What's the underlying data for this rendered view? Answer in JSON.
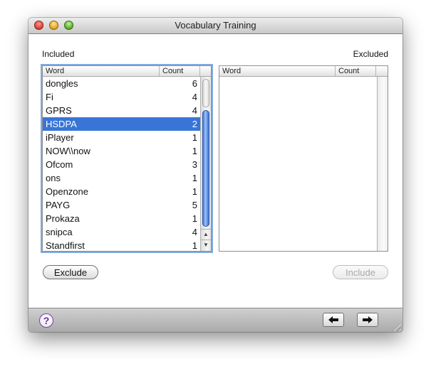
{
  "window": {
    "title": "Vocabulary Training"
  },
  "included": {
    "label": "Included",
    "columns": {
      "word": "Word",
      "count": "Count"
    },
    "rows": [
      {
        "word": "dongles",
        "count": "6"
      },
      {
        "word": "Fi",
        "count": "4"
      },
      {
        "word": "GPRS",
        "count": "4"
      },
      {
        "word": "HSDPA",
        "count": "2",
        "selected": true
      },
      {
        "word": "iPlayer",
        "count": "1"
      },
      {
        "word": "NOW\\\\now",
        "count": "1"
      },
      {
        "word": "Ofcom",
        "count": "3"
      },
      {
        "word": "ons",
        "count": "1"
      },
      {
        "word": "Openzone",
        "count": "1"
      },
      {
        "word": "PAYG",
        "count": "5"
      },
      {
        "word": "Prokaza",
        "count": "1"
      },
      {
        "word": "snipca",
        "count": "4"
      },
      {
        "word": "Standfirst",
        "count": "1"
      }
    ]
  },
  "excluded": {
    "label": "Excluded",
    "columns": {
      "word": "Word",
      "count": "Count"
    },
    "rows": []
  },
  "buttons": {
    "exclude": "Exclude",
    "include": "Include"
  },
  "footer": {
    "help": "?",
    "prev": "🡐",
    "next": "🡒"
  },
  "icons": {
    "help": "question-mark-icon",
    "prev": "arrow-left-icon",
    "next": "arrow-right-icon",
    "scroll_up": "chevron-up-icon",
    "scroll_down": "chevron-down-icon"
  },
  "colors": {
    "selection": "#3875d7",
    "focus_ring": "#7fa9e0",
    "help_accent": "#6c2aa8"
  }
}
